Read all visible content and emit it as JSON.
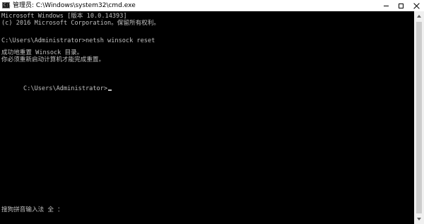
{
  "window": {
    "title": "管理员: C:\\Windows\\system32\\cmd.exe",
    "app_icon_text": "C:\\",
    "icons": {
      "app": "cmd-icon",
      "minimize": "minimize-icon",
      "maximize": "maximize-icon",
      "close": "close-icon"
    }
  },
  "console": {
    "lines": [
      "Microsoft Windows [版本 10.0.14393]",
      "(c) 2016 Microsoft Corporation。保留所有权利。",
      "",
      "C:\\Users\\Administrator>netsh winsock reset",
      "",
      "成功地重置 Winsock 目录。",
      "你必须重新启动计算机才能完成重置。",
      "",
      "",
      "C:\\Users\\Administrator>"
    ],
    "ime_status": "搜狗拼音输入法 全 ："
  },
  "colors": {
    "console_background": "#000000",
    "console_text": "#c0c0c0",
    "titlebar_background": "#ffffff"
  }
}
